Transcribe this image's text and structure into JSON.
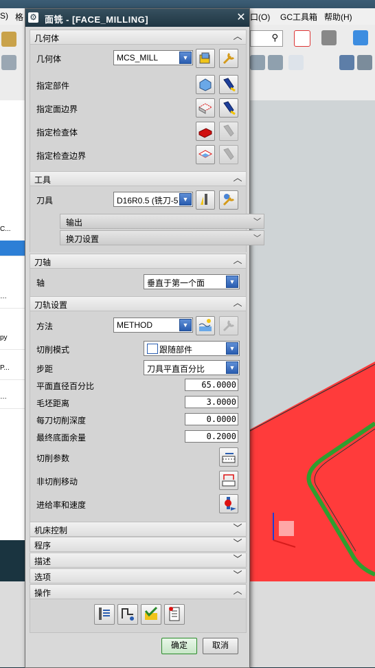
{
  "app": {
    "menu": [
      "S)",
      "格",
      "口(O)",
      "GC工具箱",
      "帮助(H)"
    ],
    "left_rows": [
      "C...",
      "…",
      "py",
      "P...",
      "…"
    ]
  },
  "dialog": {
    "title": "面铣 - [FACE_MILLING]",
    "sections": {
      "geometry": {
        "header": "几何体",
        "geometry_label": "几何体",
        "geometry_value": "MCS_MILL",
        "part_label": "指定部件",
        "face_boundary_label": "指定面边界",
        "check_body_label": "指定检查体",
        "check_boundary_label": "指定检查边界"
      },
      "tool": {
        "header": "工具",
        "tool_label": "刀具",
        "tool_value": "D16R0.5 (铣刀-5",
        "output_label": "输出",
        "tool_change_label": "换刀设置"
      },
      "axis": {
        "header": "刀轴",
        "axis_label": "轴",
        "axis_value": "垂直于第一个面"
      },
      "path": {
        "header": "刀轨设置",
        "method_label": "方法",
        "method_value": "METHOD",
        "cut_pattern_label": "切削模式",
        "cut_pattern_value": "跟随部件",
        "stepover_label": "步距",
        "stepover_value": "刀具平直百分比",
        "flat_diam_label": "平面直径百分比",
        "flat_diam_value": "65.0000",
        "blank_dist_label": "毛坯距离",
        "blank_dist_value": "3.0000",
        "depth_per_cut_label": "每刀切削深度",
        "depth_per_cut_value": "0.0000",
        "final_floor_label": "最终底面余量",
        "final_floor_value": "0.2000",
        "cut_params_label": "切削参数",
        "non_cut_label": "非切削移动",
        "feeds_label": "进给率和速度"
      },
      "machine_control": {
        "header": "机床控制"
      },
      "program": {
        "header": "程序"
      },
      "description": {
        "header": "描述"
      },
      "options": {
        "header": "选项"
      },
      "actions": {
        "header": "操作"
      }
    },
    "ok_label": "确定",
    "cancel_label": "取消"
  },
  "colors": {
    "accent": "#2a5db0",
    "title_bg": "#1f3542",
    "viewport_part": "#ff3b3b"
  }
}
